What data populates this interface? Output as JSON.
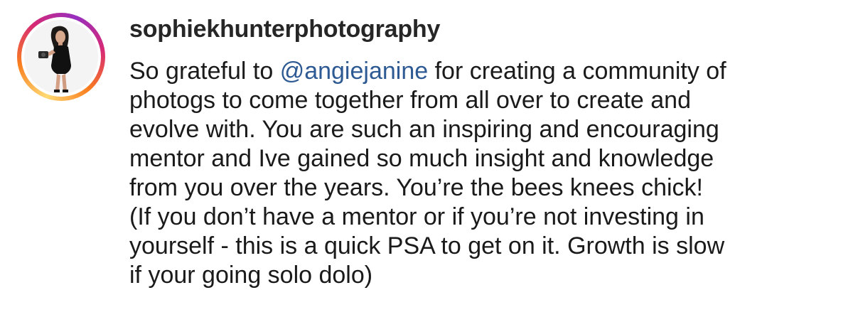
{
  "post": {
    "username": "sophiekhunterphotography",
    "avatar_icon": "profile-photo-avatar",
    "ring_colors": [
      "#feda75",
      "#fa7e1e",
      "#d62976",
      "#962fbf"
    ],
    "mention_color": "#2e5a94",
    "caption": {
      "line1_before": "So grateful to ",
      "mention": "@angiejanine",
      "line1_after": " for creating a community of",
      "lines": [
        "photogs to come together from all over to create and",
        "evolve with. You are such an inspiring and encouraging",
        "mentor and Ive gained so much insight and knowledge",
        "from you over the years. You’re the bees knees chick!",
        "(If you don’t have a mentor or if you’re not investing in",
        "yourself - this is a quick PSA to get on it. Growth is slow",
        "if your going solo dolo)"
      ]
    }
  }
}
